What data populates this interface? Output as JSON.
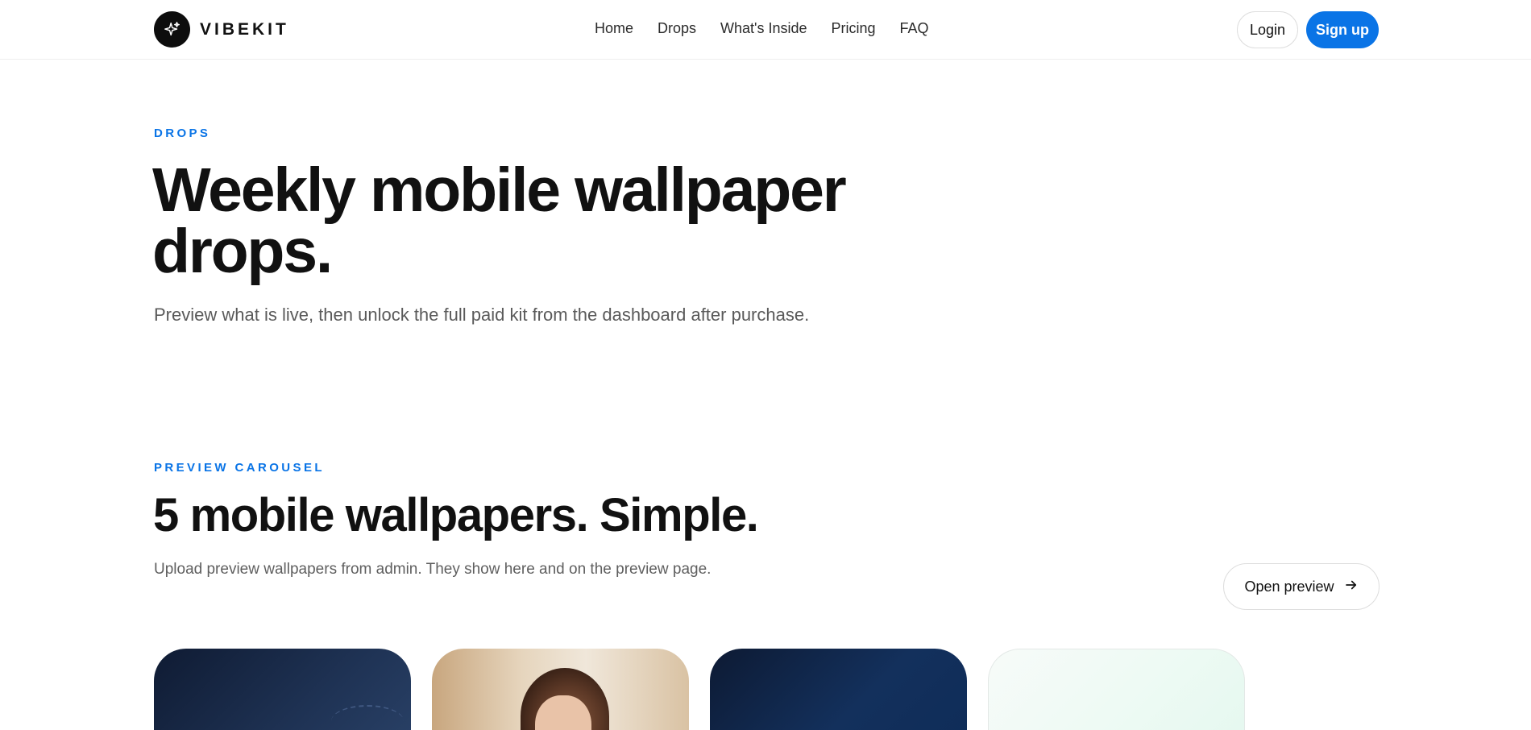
{
  "brand": {
    "name": "VIBEKIT",
    "logo_icon": "sparkle-icon"
  },
  "nav": {
    "items": [
      "Home",
      "Drops",
      "What's Inside",
      "Pricing",
      "FAQ"
    ]
  },
  "auth": {
    "login_label": "Login",
    "signup_label": "Sign up"
  },
  "colors": {
    "accent": "#0a74e6",
    "text": "#111111",
    "muted": "#5a5a5a"
  },
  "hero": {
    "eyebrow": "DROPS",
    "title": "Weekly mobile wallpaper drops.",
    "subtitle": "Preview what is live, then unlock the full paid kit from the dashboard after purchase."
  },
  "carousel": {
    "eyebrow": "PREVIEW CAROUSEL",
    "title": "5 mobile wallpapers. Simple.",
    "description": "Upload preview wallpapers from admin. They show here and on the preview page.",
    "open_preview_label": "Open preview",
    "open_preview_icon": "arrow-right-icon"
  }
}
